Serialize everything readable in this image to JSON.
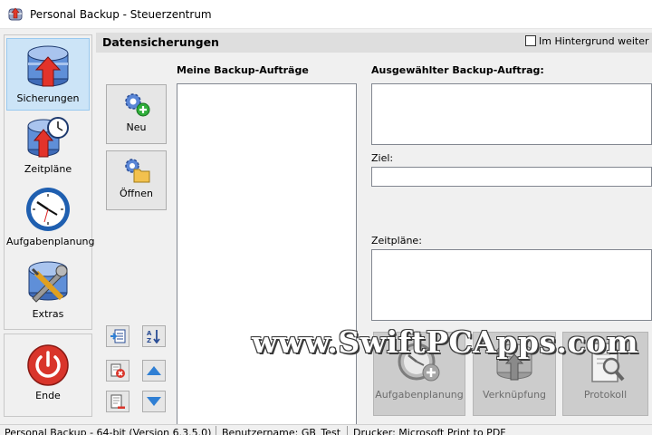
{
  "window": {
    "title": "Personal Backup - Steuerzentrum",
    "app_icon": "backup-app-icon"
  },
  "nav": {
    "items": [
      {
        "label": "Sicherungen",
        "icon": "database-upload-icon",
        "active": true
      },
      {
        "label": "Zeitpläne",
        "icon": "database-clock-icon",
        "active": false
      },
      {
        "label": "Aufgabenplanung",
        "icon": "clock-icon",
        "active": false
      },
      {
        "label": "Extras",
        "icon": "tools-icon",
        "active": false
      }
    ],
    "exit_label": "Ende"
  },
  "header": {
    "title": "Datensicherungen",
    "background_checkbox_label": "Im Hintergrund weiter au",
    "background_checked": false
  },
  "actions": {
    "new_label": "Neu",
    "open_label": "Öffnen"
  },
  "jobs": {
    "heading": "Meine Backup-Aufträge",
    "items": []
  },
  "details": {
    "heading": "Ausgewählter Backup-Auftrag:",
    "target_label": "Ziel:",
    "target_value": "",
    "schedules_label": "Zeitpläne:"
  },
  "bottom_buttons": [
    {
      "label": "Aufgabenplanung",
      "icon": "clock-add-icon"
    },
    {
      "label": "Verknüpfung",
      "icon": "shortcut-database-icon"
    },
    {
      "label": "Protokoll",
      "icon": "log-search-icon"
    }
  ],
  "watermark": "www.SwiftPCApps.com",
  "status": {
    "version": "Personal Backup - 64-bit (Version 6.3.5.0)",
    "user": "Benutzername: GB_Test",
    "printer": "Drucker: Microsoft Print to PDF"
  },
  "colors": {
    "accent": "#cce4f7",
    "exit_red": "#d9352b",
    "arrow_blue": "#2f7fd4"
  }
}
